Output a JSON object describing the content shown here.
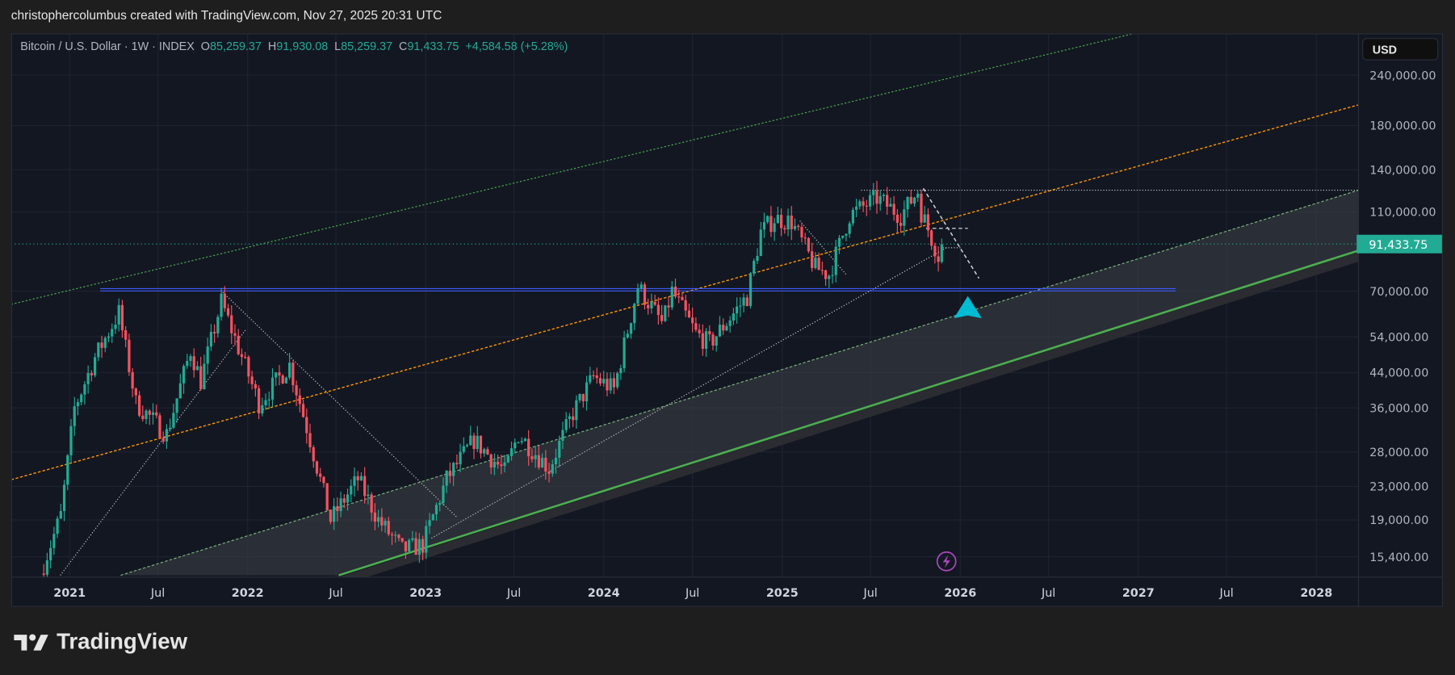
{
  "header": {
    "attribution": "christophercolumbus created with TradingView.com, Nov 27, 2025 20:31 UTC"
  },
  "legend": {
    "symbol": "Bitcoin / U.S. Dollar · 1W · INDEX",
    "open_label": "O",
    "open": "85,259.37",
    "high_label": "H",
    "high": "91,930.08",
    "low_label": "L",
    "low": "85,259.37",
    "close_label": "C",
    "close": "91,433.75",
    "change": "+4,584.58 (+5.28%)"
  },
  "currency_button": "USD",
  "brand": "TradingView",
  "colors": {
    "up": "#22ab94",
    "down": "#f7525f",
    "background": "#131722",
    "price_tag": "#22ab94",
    "support_line": "#3d5afe",
    "channel_line": "#4caf50",
    "orange_line": "#ff9800",
    "arrow": "#00bcd4"
  },
  "chart_data": {
    "type": "candlestick",
    "title": "Bitcoin / U.S. Dollar · 1W · INDEX",
    "scale": "log",
    "ylim": [
      13500,
      265000
    ],
    "y_ticks": [
      "240,000.00",
      "180,000.00",
      "140,000.00",
      "110,000.00",
      "70,000.00",
      "54,000.00",
      "44,000.00",
      "36,000.00",
      "28,000.00",
      "23,000.00",
      "19,000.00",
      "15,400.00"
    ],
    "y_tick_values": [
      240000,
      180000,
      140000,
      110000,
      70000,
      54000,
      44000,
      36000,
      28000,
      23000,
      19000,
      15400
    ],
    "last_price_label": "91,433.75",
    "last_price": 91433.75,
    "x_ticks": [
      "2021",
      "Jul",
      "2022",
      "Jul",
      "2023",
      "Jul",
      "2024",
      "Jul",
      "2025",
      "Jul",
      "2026",
      "Jul",
      "2027",
      "Jul",
      "2028"
    ],
    "x_tick_dates": [
      "2021-01-01",
      "2021-07-01",
      "2022-01-01",
      "2022-07-01",
      "2023-01-01",
      "2023-07-01",
      "2024-01-01",
      "2024-07-01",
      "2025-01-01",
      "2025-07-01",
      "2026-01-01",
      "2026-07-01",
      "2027-01-01",
      "2027-07-01",
      "2028-01-01"
    ],
    "price_path": [
      [
        "2020-11-02",
        14000
      ],
      [
        "2020-12-14",
        19500
      ],
      [
        "2021-01-11",
        36000
      ],
      [
        "2021-02-22",
        48000
      ],
      [
        "2021-04-12",
        62000
      ],
      [
        "2021-05-17",
        37000
      ],
      [
        "2021-07-19",
        31000
      ],
      [
        "2021-09-06",
        50000
      ],
      [
        "2021-09-27",
        42000
      ],
      [
        "2021-11-08",
        66000
      ],
      [
        "2022-01-24",
        37000
      ],
      [
        "2022-03-28",
        46000
      ],
      [
        "2022-05-09",
        30000
      ],
      [
        "2022-06-20",
        19000
      ],
      [
        "2022-08-15",
        24000
      ],
      [
        "2022-09-26",
        19000
      ],
      [
        "2022-11-14",
        16000
      ],
      [
        "2022-12-26",
        16500
      ],
      [
        "2023-02-13",
        24000
      ],
      [
        "2023-04-10",
        30000
      ],
      [
        "2023-06-12",
        25000
      ],
      [
        "2023-07-10",
        31000
      ],
      [
        "2023-09-11",
        25500
      ],
      [
        "2023-10-30",
        35000
      ],
      [
        "2023-12-11",
        43000
      ],
      [
        "2024-01-22",
        40000
      ],
      [
        "2024-03-11",
        72000
      ],
      [
        "2024-05-01",
        58000
      ],
      [
        "2024-05-20",
        70000
      ],
      [
        "2024-07-08",
        55000
      ],
      [
        "2024-08-05",
        52000
      ],
      [
        "2024-10-21",
        68000
      ],
      [
        "2024-11-18",
        98000
      ],
      [
        "2024-12-16",
        106000
      ],
      [
        "2025-01-20",
        104000
      ],
      [
        "2025-03-10",
        80000
      ],
      [
        "2025-04-07",
        77000
      ],
      [
        "2025-05-19",
        108000
      ],
      [
        "2025-07-14",
        119000
      ],
      [
        "2025-09-01",
        108000
      ],
      [
        "2025-10-06",
        124000
      ],
      [
        "2025-10-13",
        110000
      ],
      [
        "2025-11-17",
        86000
      ],
      [
        "2025-11-24",
        91433.75
      ]
    ],
    "annotations": {
      "support_level": 70000,
      "resistance_level": 124000
    }
  }
}
